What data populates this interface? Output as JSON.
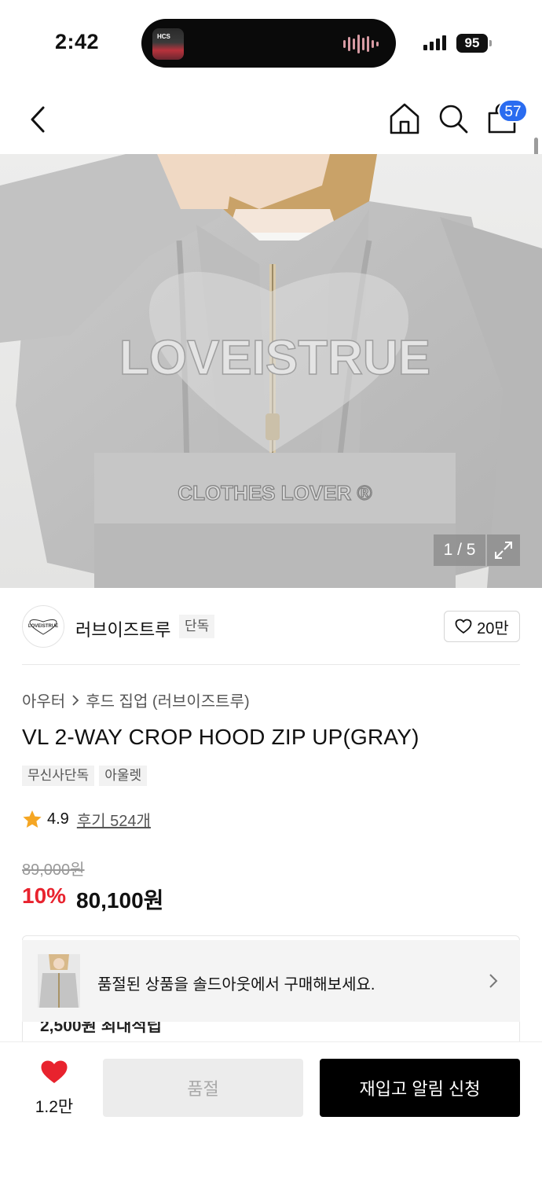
{
  "status_bar": {
    "time": "2:42",
    "battery": "95",
    "island_label": "HCS"
  },
  "header": {
    "cart_count": "57",
    "icons": [
      "back-chevron-icon",
      "home-icon",
      "search-icon",
      "shopping-bag-icon"
    ]
  },
  "hero": {
    "image_counter": "1 / 5",
    "print_text_1": "LOVEISTRUE",
    "print_text_2": "CLOTHES LOVER ®"
  },
  "brand": {
    "name": "러브이즈트루",
    "logo_text": "LOVEISTRUE",
    "exclusive_tag": "단독",
    "likes": "20만"
  },
  "product": {
    "breadcrumb": [
      "아우터",
      "후드 집업 (러브이즈트루)"
    ],
    "title": "VL 2-WAY CROP HOOD ZIP UP(GRAY)",
    "tags": [
      "무신사단독",
      "아울렛"
    ],
    "rating": "4.9",
    "reviews": "후기 524개",
    "original_price": "89,000원",
    "discount": "10%",
    "sale_price": "80,100원"
  },
  "info_box": {
    "partial_text": "2,500원 최대적립",
    "banner_text": "품절된 상품을 솔드아웃에서 구매해보세요."
  },
  "bottom_bar": {
    "wish_count": "1.2만",
    "soldout_label": "품절",
    "restock_label": "재입고 알림 신청"
  },
  "colors": {
    "accent_blue": "#2a6cf0",
    "discount_red": "#e8232e",
    "star": "#f5a623",
    "heart": "#e8232e"
  }
}
